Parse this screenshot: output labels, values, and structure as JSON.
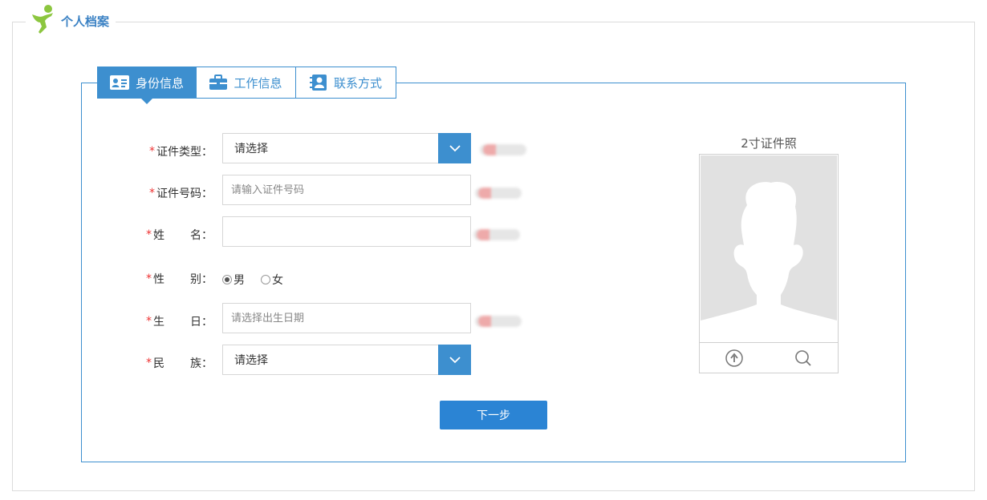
{
  "header": {
    "title": "个人档案",
    "logo_icon": "running-person-icon"
  },
  "tabs": [
    {
      "label": "身份信息",
      "icon": "id-card-icon",
      "active": true
    },
    {
      "label": "工作信息",
      "icon": "briefcase-icon",
      "active": false
    },
    {
      "label": "联系方式",
      "icon": "contact-book-icon",
      "active": false
    }
  ],
  "form": {
    "required_mark": "*",
    "colon": "：",
    "id_type": {
      "label": "证件类型",
      "value": "请选择"
    },
    "id_number": {
      "label": "证件号码",
      "placeholder": "请输入证件号码",
      "value": ""
    },
    "name": {
      "label_a": "姓",
      "label_b": "名",
      "value": ""
    },
    "gender": {
      "label_a": "性",
      "label_b": "别",
      "options": [
        "男",
        "女"
      ],
      "selected": "男"
    },
    "birthday": {
      "label_a": "生",
      "label_b": "日",
      "placeholder": "请选择出生日期"
    },
    "ethnicity": {
      "label_a": "民",
      "label_b": "族",
      "value": "请选择"
    },
    "next_button": "下一步"
  },
  "photo": {
    "title": "2寸证件照",
    "upload_icon": "upload-icon",
    "preview_icon": "search-icon"
  },
  "colors": {
    "accent": "#3d8fcf",
    "button": "#2b84d4",
    "required": "#ee3333"
  }
}
